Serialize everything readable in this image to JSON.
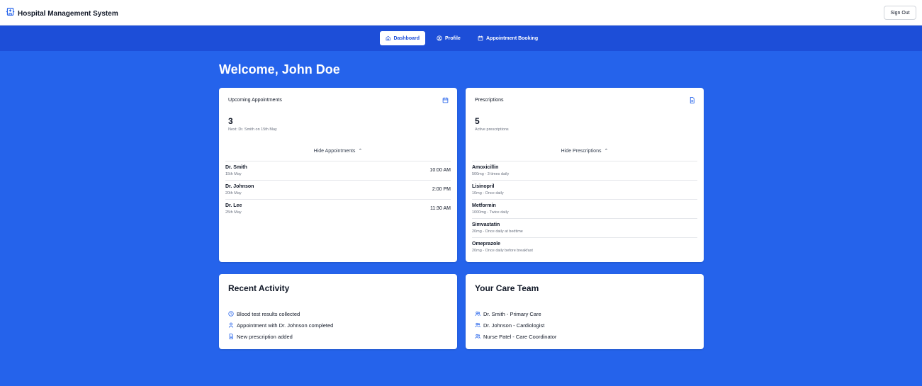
{
  "app": {
    "title": "Hospital Management System",
    "sign_out_label": "Sign Out"
  },
  "nav": {
    "items": [
      {
        "label": "Dashboard",
        "icon": "home-icon",
        "active": true
      },
      {
        "label": "Profile",
        "icon": "user-circle-icon",
        "active": false
      },
      {
        "label": "Appointment Booking",
        "icon": "calendar-icon",
        "active": false
      }
    ]
  },
  "welcome": "Welcome, John Doe",
  "appointments": {
    "title": "Upcoming Appointments",
    "icon": "calendar-icon",
    "count": "3",
    "next": "Next: Dr. Smith on 15th May",
    "toggle_label": "Hide Appointments",
    "items": [
      {
        "doctor": "Dr. Smith",
        "date": "15th May",
        "time": "10:00 AM"
      },
      {
        "doctor": "Dr. Johnson",
        "date": "20th May",
        "time": "2:00 PM"
      },
      {
        "doctor": "Dr. Lee",
        "date": "25th May",
        "time": "11:30 AM"
      }
    ]
  },
  "prescriptions": {
    "title": "Prescriptions",
    "icon": "document-icon",
    "count": "5",
    "subtitle": "Active prescriptions",
    "toggle_label": "Hide Prescriptions",
    "items": [
      {
        "name": "Amoxicillin",
        "dosage": "500mg - 3 times daily"
      },
      {
        "name": "Lisinopril",
        "dosage": "10mg - Once daily"
      },
      {
        "name": "Metformin",
        "dosage": "1000mg - Twice daily"
      },
      {
        "name": "Simvastatin",
        "dosage": "20mg - Once daily at bedtime"
      },
      {
        "name": "Omeprazole",
        "dosage": "20mg - Once daily before breakfast"
      }
    ]
  },
  "recent_activity": {
    "title": "Recent Activity",
    "items": [
      {
        "text": "Blood test results collected",
        "icon": "clock-icon"
      },
      {
        "text": "Appointment with Dr. Johnson completed",
        "icon": "user-icon"
      },
      {
        "text": "New prescription added",
        "icon": "document-icon"
      }
    ]
  },
  "care_team": {
    "title": "Your Care Team",
    "items": [
      {
        "text": "Dr. Smith - Primary Care",
        "icon": "users-icon"
      },
      {
        "text": "Dr. Johnson - Cardiologist",
        "icon": "users-icon"
      },
      {
        "text": "Nurse Patel - Care Coordinator",
        "icon": "users-icon"
      }
    ]
  },
  "colors": {
    "primary": "#2563eb",
    "nav": "#1d4ed8",
    "card": "#ffffff"
  }
}
